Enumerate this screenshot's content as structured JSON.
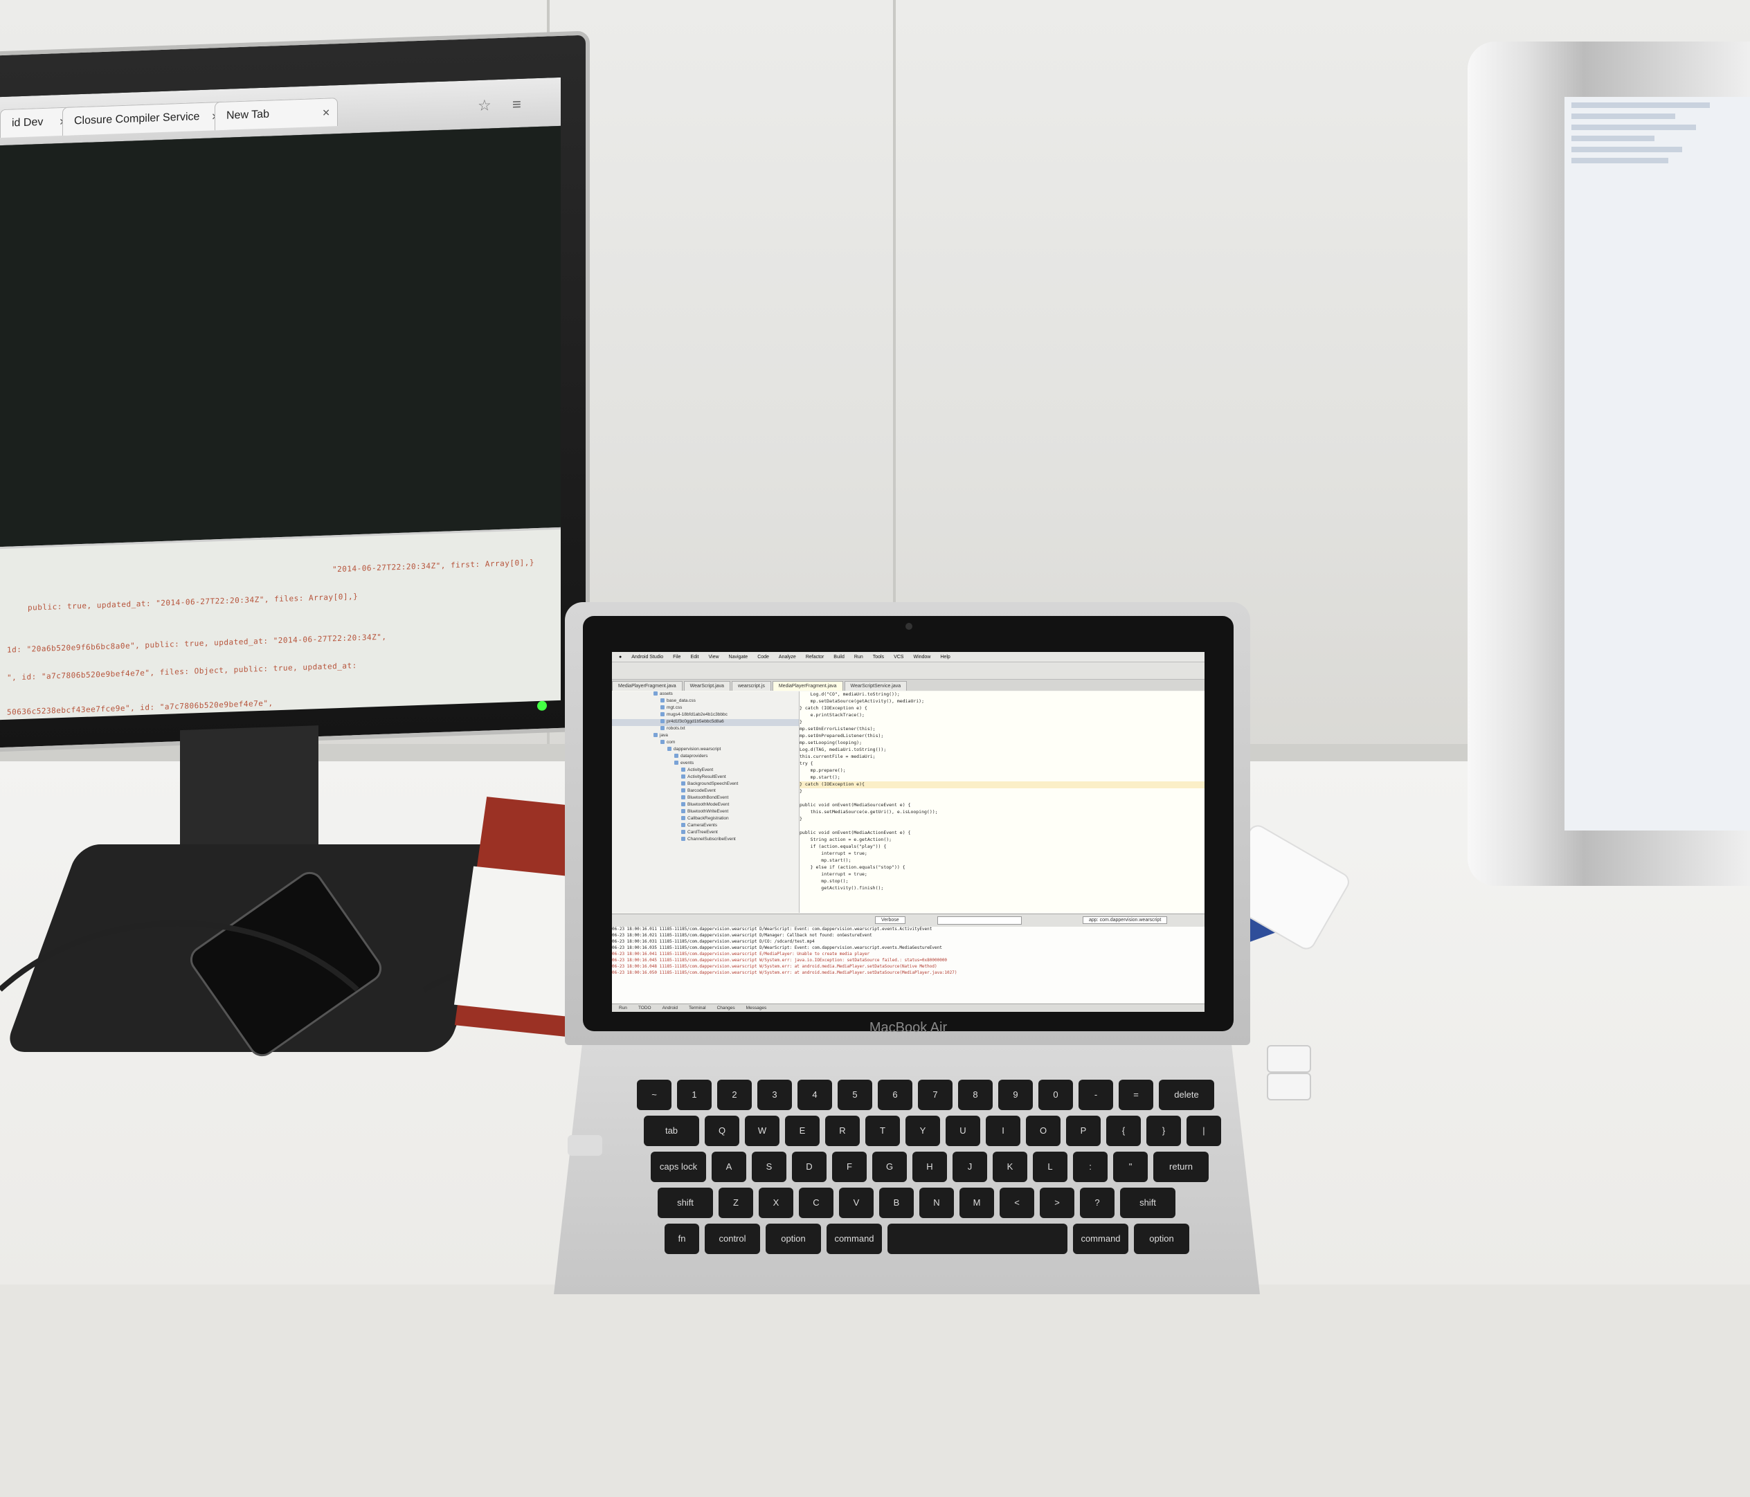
{
  "left_monitor": {
    "tabs": [
      {
        "label": "id Dev"
      },
      {
        "label": "Closure Compiler Service"
      },
      {
        "label": "New Tab"
      }
    ],
    "json_lines": [
      "\"2014-06-27T22:20:34Z\", first: Array[0],}",
      "public: true, updated_at: \"2014-06-27T22:20:34Z\", files: Array[0],}",
      "1d: \"20a6b520e9f6b6bc8a0e\", public: true, updated_at: \"2014-06-27T22:20:34Z\",",
      "\", id: \"a7c7806b520e9bef4e7e\", files: Object, public: true, updated_at:",
      "50636c5238ebcf43ee7fce9e\", id: \"a7c7806b520e9bef4e7e\","
    ]
  },
  "laptop": {
    "brand_label": "MacBook Air",
    "menubar": [
      "Android Studio",
      "File",
      "Edit",
      "View",
      "Navigate",
      "Code",
      "Analyze",
      "Refactor",
      "Build",
      "Run",
      "Tools",
      "VCS",
      "Window",
      "Help"
    ],
    "editor_tabs": [
      "MediaPlayerFragment.java",
      "WearScript.java",
      "wearscript.js",
      "MediaPlayerFragment.java",
      "WearScriptService.java"
    ],
    "project_tree": [
      "assets",
      "base_data.css",
      "mgt.css",
      "mugs4-18bfd1ab2e4b1c3bbbc",
      "pr4d1f3c0ggd1b5ebbc5d8a6",
      "robots.txt",
      "java",
      "com",
      "dappervision.wearscript",
      "dataproviders",
      "events",
      "ActivityEvent",
      "ActivityResultEvent",
      "BackgroundSpeechEvent",
      "BarcodeEvent",
      "BluetoothBondEvent",
      "BluetoothModeEvent",
      "BluetoothWriteEvent",
      "CallbackRegistration",
      "CameraEvents",
      "CardTreeEvent",
      "ChannelSubscribeEvent"
    ],
    "code_lines": [
      "    Log.d(\"CO\", mediaUri.toString());",
      "    mp.setDataSource(getActivity(), mediaUri);",
      "} catch (IOException e) {",
      "    e.printStackTrace();",
      "}",
      "mp.setOnErrorListener(this);",
      "mp.setOnPreparedListener(this);",
      "mp.setLooping(looping);",
      "Log.d(TAG, mediaUri.toString());",
      "this.currentFile = mediaUri;",
      "try {",
      "    mp.prepare();",
      "    mp.start();",
      "} catch (IOException e){",
      "}",
      "",
      "public void onEvent(MediaSourceEvent e) {",
      "    this.setMediaSource(e.getUri(), e.isLooping());",
      "}",
      "",
      "public void onEvent(MediaActionEvent e) {",
      "    String action = e.getAction();",
      "    if (action.equals(\"play\")) {",
      "        interrupt = true;",
      "        mp.start();",
      "    } else if (action.equals(\"stop\")) {",
      "        interrupt = true;",
      "        mp.stop();",
      "        getActivity().finish();"
    ],
    "logcat_level": "Verbose",
    "logcat_app": "app: com.dappervision.wearscript",
    "log_lines": [
      "06-23 18:00:16.011 11185-11185/com.dappervision.wearscript D/WearScript: Event: com.dappervision.wearscript.events.ActivityEvent",
      "06-23 18:00:16.021 11185-11185/com.dappervision.wearscript D/Manager: Callback not found: onGestureEvent",
      "06-23 18:00:16.031 11185-11185/com.dappervision.wearscript D/CO: /sdcard/test.mp4",
      "06-23 18:00:16.035 11185-11185/com.dappervision.wearscript D/WearScript: Event: com.dappervision.wearscript.events.MediaGestureEvent",
      "06-23 18:00:16.041 11185-11185/com.dappervision.wearscript E/MediaPlayer: Unable to create media player",
      "06-23 18:00:16.045 11185-11185/com.dappervision.wearscript W/System.err: java.io.IOException: setDataSource failed.: status=0x80000000",
      "06-23 18:00:16.048 11185-11185/com.dappervision.wearscript W/System.err: at android.media.MediaPlayer.setDataSource(Native Method)",
      "06-23 18:00:16.050 11185-11185/com.dappervision.wearscript W/System.err: at android.media.MediaPlayer.setDataSource(MediaPlayer.java:1027)"
    ],
    "status_items": [
      "Run",
      "TODO",
      "Android",
      "Terminal",
      "Changes",
      "Messages"
    ]
  },
  "keyboard": {
    "row_number": [
      "~",
      "1",
      "2",
      "3",
      "4",
      "5",
      "6",
      "7",
      "8",
      "9",
      "0",
      "-",
      "=",
      "delete"
    ],
    "row_q": [
      "tab",
      "Q",
      "W",
      "E",
      "R",
      "T",
      "Y",
      "U",
      "I",
      "O",
      "P",
      "{",
      "}",
      "|"
    ],
    "row_a": [
      "caps lock",
      "A",
      "S",
      "D",
      "F",
      "G",
      "H",
      "J",
      "K",
      "L",
      ":",
      "\"",
      "return"
    ],
    "row_z": [
      "shift",
      "Z",
      "X",
      "C",
      "V",
      "B",
      "N",
      "M",
      "<",
      ">",
      "?",
      "shift"
    ],
    "row_bottom": [
      "fn",
      "control",
      "option",
      "command",
      "",
      "command",
      "option"
    ]
  }
}
